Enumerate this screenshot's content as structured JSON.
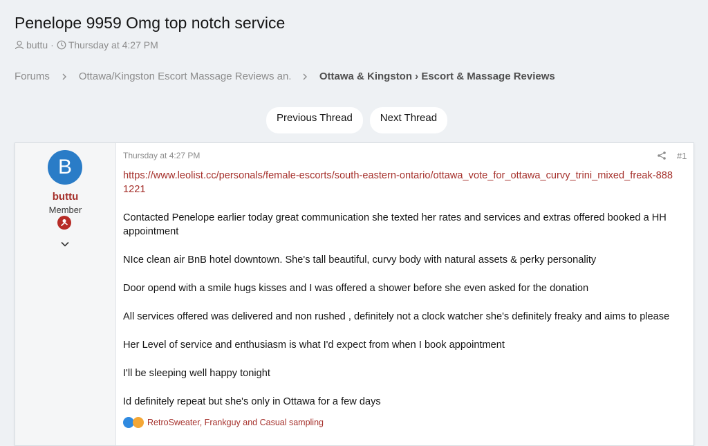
{
  "thread": {
    "title": "Penelope 9959 Omg top notch service",
    "author": "buttu",
    "date": "Thursday at 4:27 PM"
  },
  "breadcrumb": [
    {
      "label": "Forums"
    },
    {
      "label": "Ottawa/Kingston Escort Massage Reviews an..."
    },
    {
      "label": "Ottawa & Kingston › Escort & Massage Reviews"
    }
  ],
  "nav": {
    "previous": "Previous Thread",
    "next": "Next Thread"
  },
  "post": {
    "user": {
      "avatar_letter": "B",
      "name": "buttu",
      "title": "Member"
    },
    "date": "Thursday at 4:27 PM",
    "number": "#1",
    "link": "https://www.leolist.cc/personals/female-escorts/south-eastern-ontario/ottawa_vote_for_ottawa_curvy_trini_mixed_freak-8881221",
    "paragraphs": [
      "Contacted Penelope earlier today great communication she texted her rates and services and extras offered booked a HH appointment",
      "NIce clean air BnB hotel downtown. She's tall beautiful, curvy body with natural assets & perky personality",
      "Door opend with a smile hugs kisses and I was offered a shower before she even asked for the donation",
      "All services offered was delivered and non rushed , definitely not a clock watcher she's definitely freaky and aims to please",
      "Her Level of service and enthusiasm is what I'd expect from when I book appointment",
      "I'll be sleeping well happy tonight",
      "Id definitely repeat but she's only in Ottawa for a few days"
    ],
    "reactions": "RetroSweater, Frankguy and Casual sampling"
  },
  "colors": {
    "accent": "#a5302b",
    "avatar": "#2a7cc7",
    "background": "#eef1f4"
  },
  "icons": [
    "user-icon",
    "clock-icon",
    "chevron-right-icon",
    "share-icon",
    "chevron-down-icon",
    "like-icon",
    "love-icon",
    "badge-icon"
  ]
}
